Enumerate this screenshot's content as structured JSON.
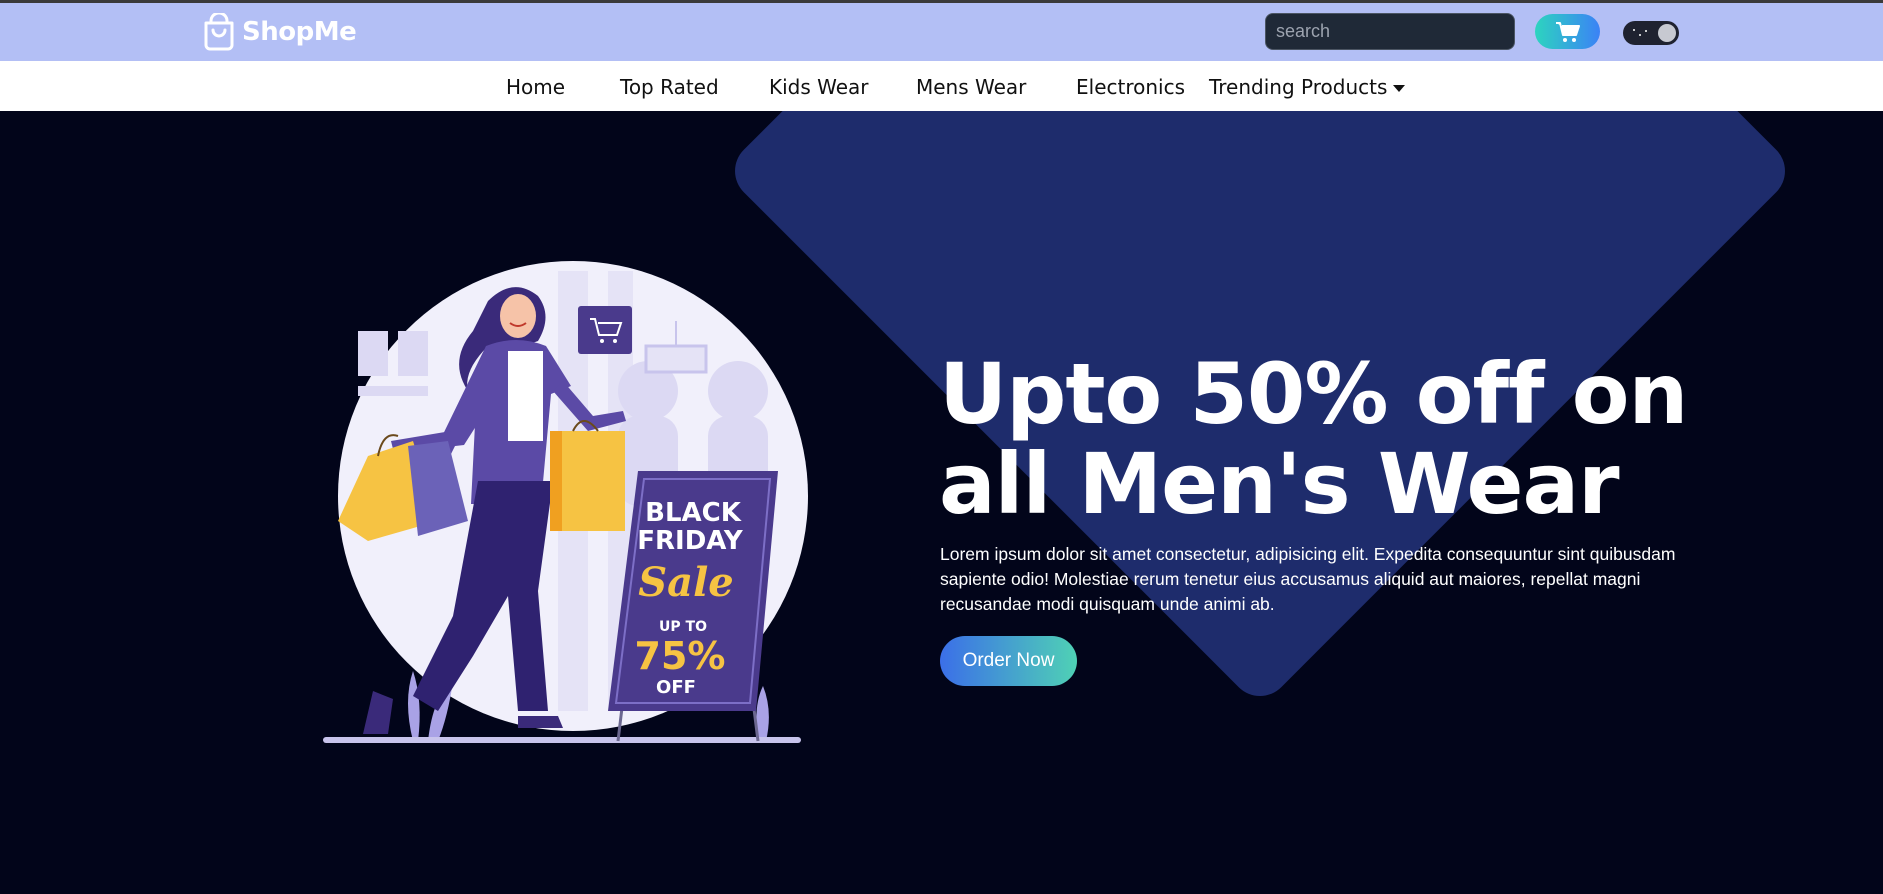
{
  "brand": {
    "name": "ShopMe"
  },
  "header": {
    "search_placeholder": "search",
    "cart_icon": "cart-icon",
    "logo_icon": "shopping-bag-icon"
  },
  "nav": {
    "items": [
      {
        "label": "Home"
      },
      {
        "label": "Top Rated"
      },
      {
        "label": "Kids Wear"
      },
      {
        "label": "Mens Wear"
      },
      {
        "label": "Electronics"
      },
      {
        "label": "Trending Products"
      }
    ]
  },
  "hero": {
    "headline": "Upto 50% off on all Men's Wear",
    "description": "Lorem ipsum dolor sit amet consectetur, adipisicing elit. Expedita consequuntur sint quibusdam sapiente odio! Molestiae rerum tenetur eius accusamus aliquid aut maiores, repellat magni recusandae modi quisquam unde animi ab.",
    "cta_label": "Order Now",
    "sign": {
      "line1": "BLACK",
      "line2": "FRIDAY",
      "line3": "Sale",
      "line4": "UP TO",
      "line5": "75%",
      "line6": "OFF"
    }
  },
  "colors": {
    "header_bg": "#b3bff5",
    "hero_bg": "#02051a",
    "diamond": "#1e2c6c",
    "accent_gradient_start": "#3b6fe8",
    "accent_gradient_end": "#4fd1b5"
  }
}
